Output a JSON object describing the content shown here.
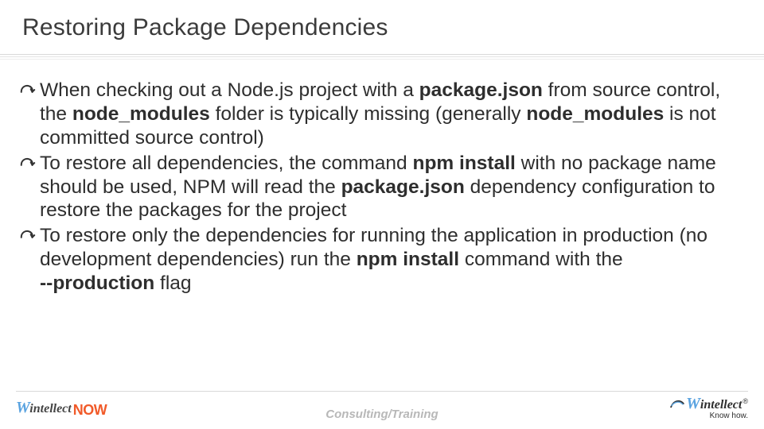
{
  "title": "Restoring Package Dependencies",
  "bullets": [
    {
      "pre": "When checking out a Node.js project with a ",
      "b1": "package.json",
      "mid1": " from source control, the ",
      "b2": "node_modules",
      "mid2": " folder is typically missing (generally ",
      "b3": "node_modules",
      "post": " is not committed source control)"
    },
    {
      "pre": "To restore all dependencies, the command ",
      "b1": "npm install",
      "mid1": " with no package name should be used, NPM will read the ",
      "b2": "package.json",
      "post": " dependency configuration to restore the packages for the project"
    },
    {
      "pre": "To restore only the dependencies for running the application in production (no development dependencies) run the ",
      "b1": "npm install",
      "mid1": " command with the",
      "br": true,
      "b2": "--production",
      "post": " flag"
    }
  ],
  "footer": {
    "center": "Consulting/Training",
    "left_w": "W",
    "left_intellect": "intellect",
    "left_now": "NOW",
    "right_w": "W",
    "right_intellect": "intellect",
    "right_reg": "®",
    "right_tagline": "Know how."
  }
}
